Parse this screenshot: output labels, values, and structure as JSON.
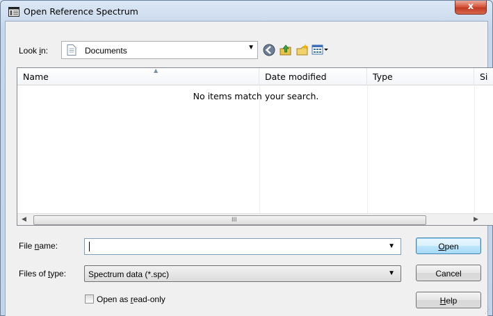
{
  "window": {
    "title": "Open Reference Spectrum",
    "close_glyph": "x"
  },
  "toolbar": {
    "look_in_prefix": "Look ",
    "look_in_mnemonic": "i",
    "look_in_suffix": "n:",
    "current_folder": "Documents",
    "icons": [
      "back-icon",
      "up-folder-icon",
      "new-folder-icon",
      "view-menu-icon"
    ]
  },
  "file_list": {
    "columns": [
      "Name",
      "Date modified",
      "Type",
      "Si"
    ],
    "empty_message": "No items match your search.",
    "scroll_grip": "III"
  },
  "form": {
    "file_name_prefix": "File ",
    "file_name_mnemonic": "n",
    "file_name_suffix": "ame:",
    "file_name_value": "",
    "file_type_prefix": "Files of ",
    "file_type_mnemonic": "t",
    "file_type_suffix": "ype:",
    "file_type_value": "Spectrum data (*.spc)",
    "read_only_prefix": "Open as ",
    "read_only_mnemonic": "r",
    "read_only_suffix": "ead-only",
    "read_only_checked": false
  },
  "buttons": {
    "open_mnemonic": "O",
    "open_rest": "pen",
    "cancel": "Cancel",
    "help_mnemonic": "H",
    "help_rest": "elp"
  }
}
